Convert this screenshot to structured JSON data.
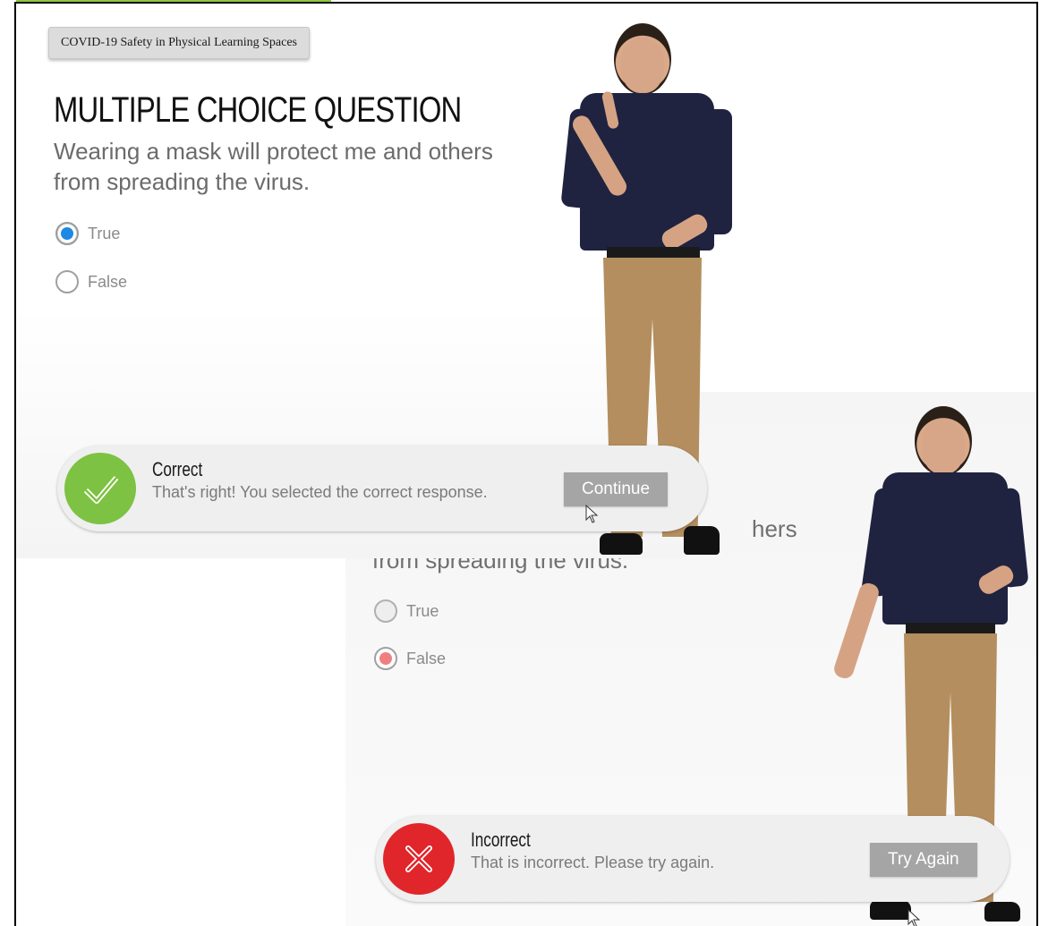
{
  "course_badge": "COVID-19 Safety in Physical Learning Spaces",
  "slide1": {
    "title": "MULTIPLE CHOICE QUESTION",
    "question_line1": "Wearing a mask will protect me and others",
    "question_line2": "from spreading the virus.",
    "options": [
      {
        "label": "True",
        "selected": true
      },
      {
        "label": "False",
        "selected": false
      }
    ],
    "feedback": {
      "heading": "Correct",
      "message": "That's right!  You selected the correct response.",
      "button": "Continue",
      "color": "#7dc242"
    }
  },
  "slide2": {
    "question_fragment_right": "hers",
    "question_fragment_line2": "from spreading the virus.",
    "options": [
      {
        "label": "True",
        "selected": false
      },
      {
        "label": "False",
        "selected": true
      }
    ],
    "feedback": {
      "heading": "Incorrect",
      "message": "That is incorrect. Please try again.",
      "button": "Try Again",
      "color": "#e0262b"
    }
  },
  "colors": {
    "accent_green": "#8cc63f",
    "radio_selected_blue": "#1e88e5",
    "radio_selected_red": "#f08080",
    "button_gray": "#a5a5a5"
  }
}
